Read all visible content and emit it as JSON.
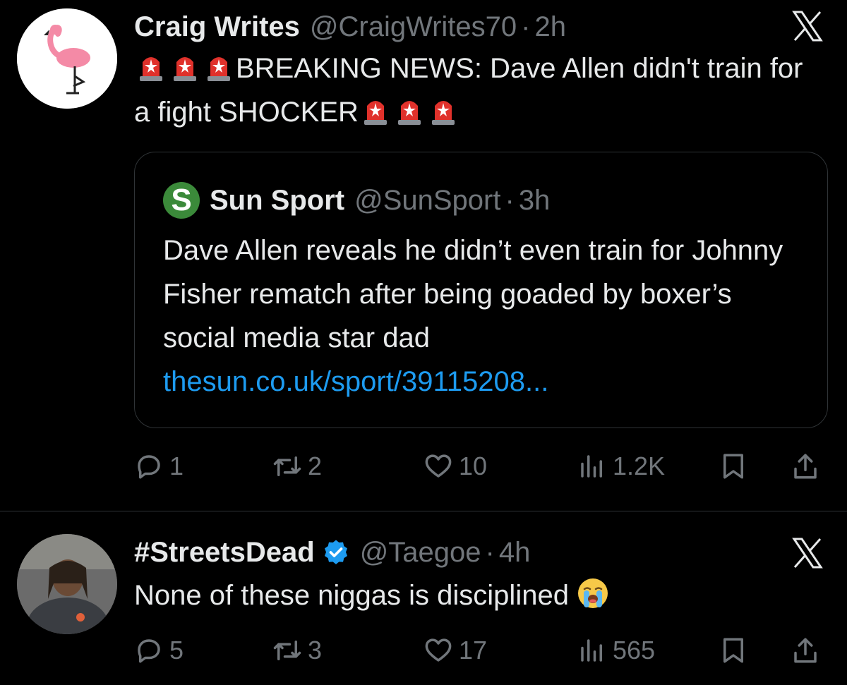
{
  "tweets": [
    {
      "author": "Craig Writes",
      "handle": "@CraigWrites70",
      "separator": "·",
      "time": "2h",
      "text_part1": "BREAKING NEWS: Dave Allen didn't train for a fight SHOCKER",
      "quote": {
        "author": "Sun Sport",
        "logo_letter": "S",
        "handle": "@SunSport",
        "separator": "·",
        "time": "3h",
        "text": "Dave Allen reveals he didn’t even train for Johnny Fisher rematch after being goaded by boxer’s social media star dad",
        "link": "thesun.co.uk/sport/39115208..."
      },
      "stats": {
        "replies": "1",
        "retweets": "2",
        "likes": "10",
        "views": "1.2K"
      }
    },
    {
      "author": "#StreetsDead",
      "handle": "@Taegoe",
      "separator": "·",
      "time": "4h",
      "text": "None of these niggas is disciplined",
      "stats": {
        "replies": "5",
        "retweets": "3",
        "likes": "17",
        "views": "565"
      }
    }
  ],
  "icons": {
    "siren": "police-car-light-emoji",
    "crying": "loudly-crying-face-emoji",
    "verified": "verified-badge-icon",
    "close": "x-icon"
  },
  "colors": {
    "background": "#000000",
    "text": "#e7e9ea",
    "muted": "#71767b",
    "link": "#1d9bf0",
    "verified": "#1d9bf0",
    "siren": "#e0312b"
  }
}
